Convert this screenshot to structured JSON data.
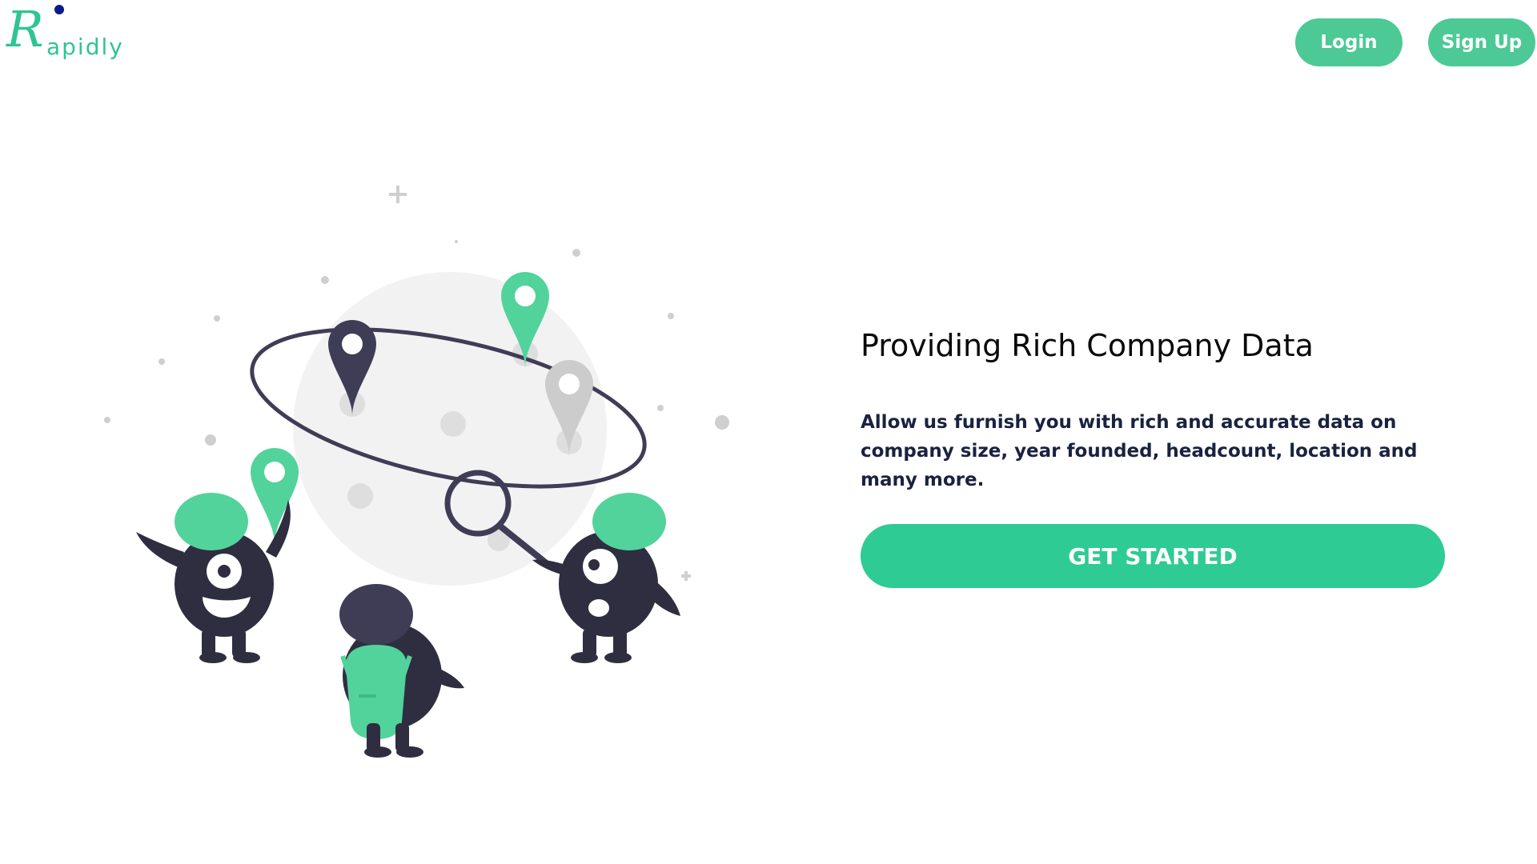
{
  "header": {
    "logo_text": "apidly",
    "logo_initial": "R",
    "login_label": "Login",
    "signup_label": "Sign Up"
  },
  "hero": {
    "title": "Providing Rich Company Data",
    "description": "Allow us furnish you with rich and accurate data on company size, year founded, headcount, location and many more.",
    "cta_label": "GET STARTED"
  },
  "colors": {
    "brand_green": "#2ec592",
    "button_green": "#4cc995",
    "cta_green": "#2ecb94",
    "logo_dot": "#0b1a8a",
    "text_dark": "#1a2240",
    "character_dark": "#2f2e41"
  },
  "illustration": {
    "subject": "map-search-illustration"
  }
}
